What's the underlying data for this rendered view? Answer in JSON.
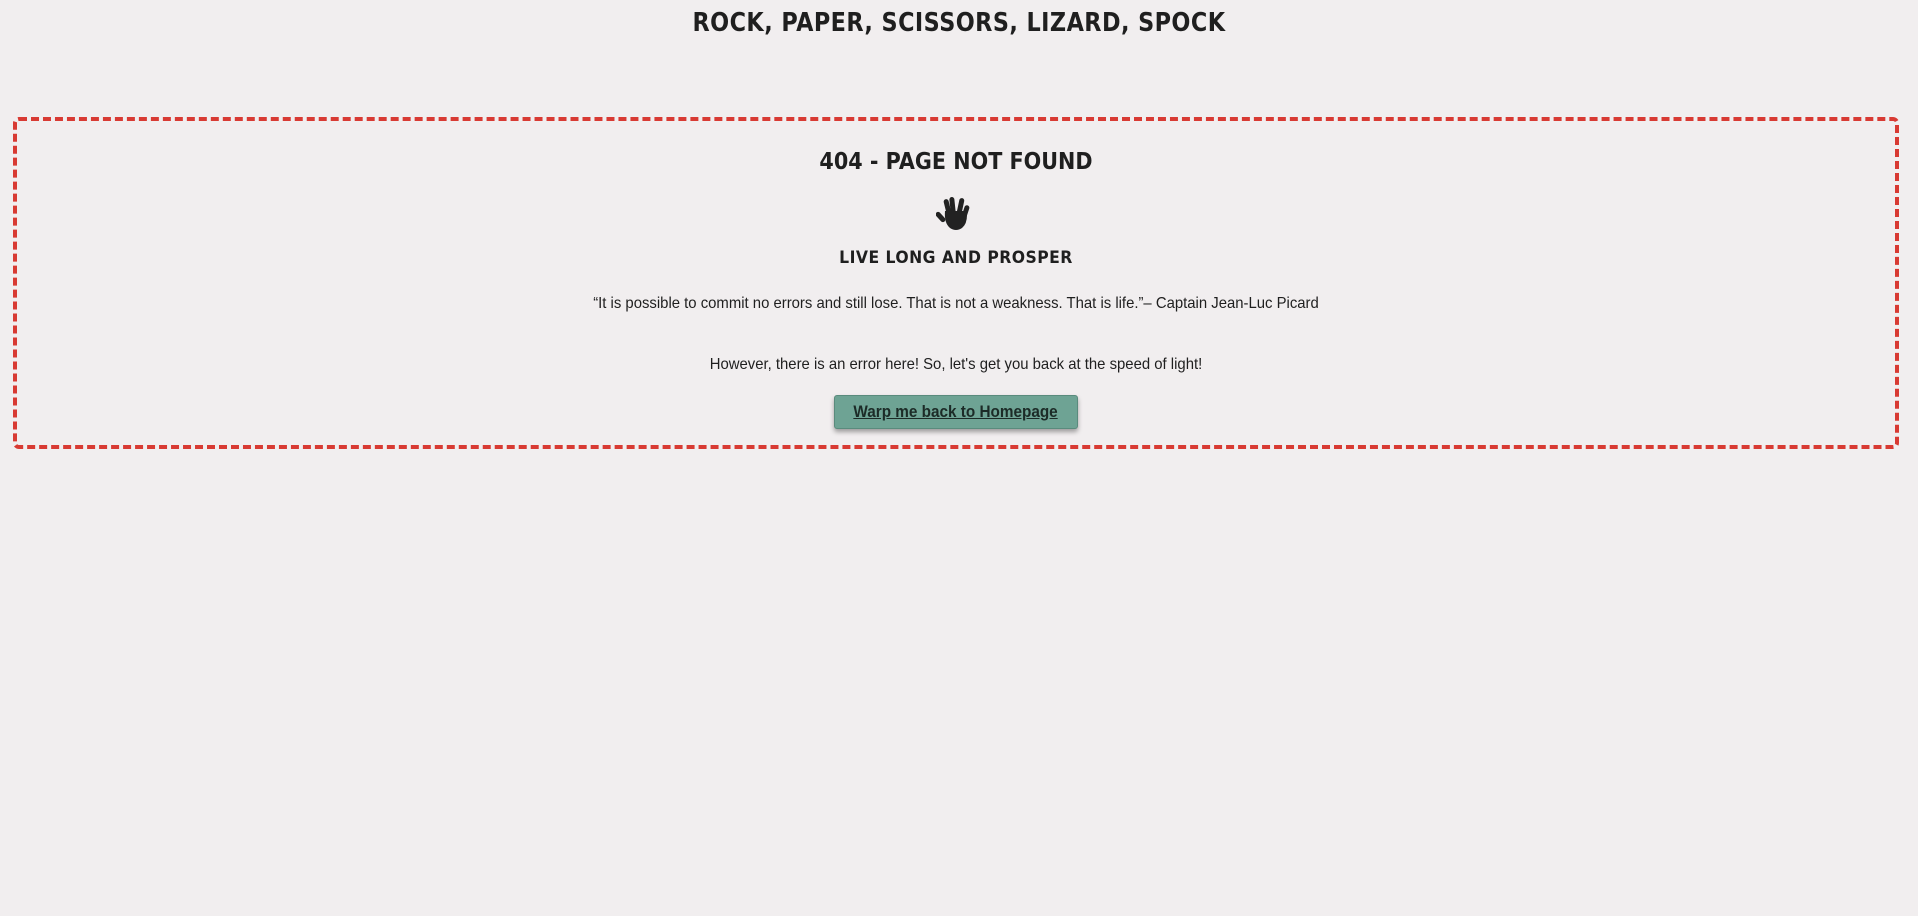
{
  "header": {
    "title": "ROCK, PAPER, SCISSORS, LIZARD, SPOCK"
  },
  "error": {
    "title": "404 - PAGE NOT FOUND",
    "icon": "vulcan-salute-icon",
    "subheading": "LIVE LONG AND PROSPER",
    "quote": "“It is possible to commit no errors and still lose. That is not a weakness. That is life.”– Captain Jean-Luc Picard",
    "message": "However, there is an error here! So, let's get you back at the speed of light!",
    "button_label": "Warp me back to Homepage"
  },
  "colors": {
    "background": "#f1eeef",
    "border": "#d83a33",
    "button": "#6ea394",
    "text": "#1f1f1f"
  }
}
